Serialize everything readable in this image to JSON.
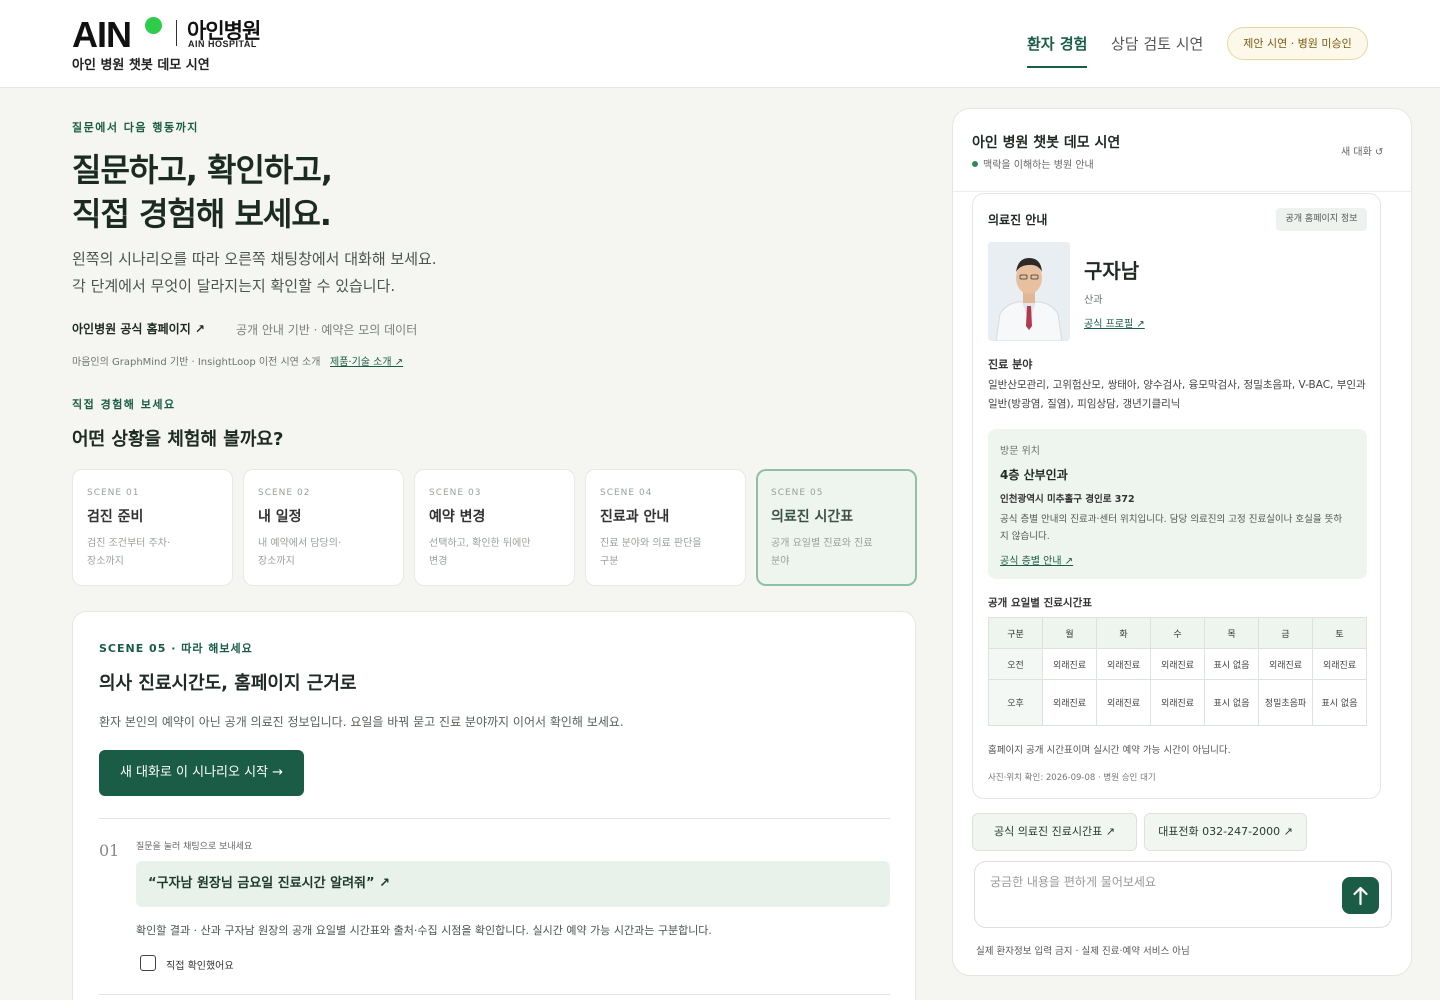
{
  "header": {
    "logo_text": "AIN",
    "logo_kr": "아인병원",
    "logo_en": "AIN HOSPITAL",
    "subtitle": "아인 병원 챗봇 데모 시연",
    "tabs": [
      {
        "label": "환자 경험",
        "active": true
      },
      {
        "label": "상담 검토 시연",
        "active": false
      }
    ],
    "badge": "제안 시연 · 병원 미승인"
  },
  "hero": {
    "eyebrow": "질문에서 다음 행동까지",
    "title_line1": "질문하고, 확인하고,",
    "title_line2": "직접 경험해 보세요.",
    "desc_line1": "왼쪽의 시나리오를 따라 오른쪽 채팅창에서 대화해 보세요.",
    "desc_line2": "각 단계에서 무엇이 달라지는지 확인할 수 있습니다.",
    "official_link": "아인병원 공식 홈페이지 ↗",
    "official_note": "공개 안내 기반 · 예약은 모의 데이터",
    "tech_note": "마음인의 GraphMind 기반 · InsightLoop 이전 시연 소개",
    "tech_link": "제품·기술 소개 ↗"
  },
  "scenes": {
    "eyebrow": "직접 경험해 보세요",
    "question": "어떤 상황을 체험해 볼까요?",
    "items": [
      {
        "label": "SCENE 01",
        "name": "검진 준비",
        "desc_1": "검진 조건부터 주차·",
        "desc_2": "장소까지",
        "active": false
      },
      {
        "label": "SCENE 02",
        "name": "내 일정",
        "desc_1": "내 예약에서 담당의·",
        "desc_2": "장소까지",
        "active": false
      },
      {
        "label": "SCENE 03",
        "name": "예약 변경",
        "desc_1": "선택하고, 확인한 뒤에만",
        "desc_2": "변경",
        "active": false
      },
      {
        "label": "SCENE 04",
        "name": "진료과 안내",
        "desc_1": "진료 분야와 의료 판단을",
        "desc_2": "구분",
        "active": false
      },
      {
        "label": "SCENE 05",
        "name": "의료진 시간표",
        "desc_1": "공개 요일별 진료와 진료",
        "desc_2": "분야",
        "active": true
      }
    ]
  },
  "panel": {
    "eyebrow": "SCENE 05 · 따라 해보세요",
    "title": "의사 진료시간도, 홈페이지 근거로",
    "desc": "환자 본인의 예약이 아닌 공개 의료진 정보입니다. 요일을 바꿔 묻고 진료 분야까지 이어서 확인해 보세요.",
    "start_button": "새 대화로 이 시나리오 시작 →",
    "step": {
      "number": "01",
      "hint": "질문을 눌러 채팅으로 보내세요",
      "question": "“구자남 원장님 금요일 진료시간 알려줘” ↗",
      "result": "확인할 결과 · 산과 구자남 원장의 공개 요일별 시간표와 출처·수집 시점을 확인합니다. 실시간 예약 가능 시간과는 구분합니다.",
      "check_label": "직접 확인했어요"
    }
  },
  "chat": {
    "title": "아인 병원 챗봇 데모 시연",
    "status": "맥락을 이해하는 병원 안내",
    "new_chat": "새 대화 ↺",
    "card": {
      "title": "의료진 안내",
      "badge": "공개 홈페이지 정보",
      "doctor_name": "구자남",
      "department": "산과",
      "profile_link": "공식 프로필 ↗",
      "specialty_heading": "진료 분야",
      "specialty": "일반산모관리, 고위험산모, 쌍태아, 양수검사, 융모막검사, 정밀초음파, V-BAC, 부인과 일반(방광염, 질염), 피임상담, 갱년기클리닉",
      "location": {
        "label": "방문 위치",
        "floor": "4층 산부인과",
        "address": "인천광역시 미추홀구 경인로 372",
        "note": "공식 층별 안내의 진료과·센터 위치입니다. 담당 의료진의 고정 진료실이나 호실을 뜻하지 않습니다.",
        "link": "공식 층별 안내 ↗"
      },
      "schedule_heading": "공개 요일별 진료시간표",
      "schedule": {
        "headers": [
          "구분",
          "월",
          "화",
          "수",
          "목",
          "금",
          "토"
        ],
        "rows": [
          [
            "오전",
            "외래진료",
            "외래진료",
            "외래진료",
            "표시 없음",
            "외래진료",
            "외래진료"
          ],
          [
            "오후",
            "외래진료",
            "외래진료",
            "외래진료",
            "표시 없음",
            "정밀초음파",
            "표시 없음"
          ]
        ]
      },
      "note": "홈페이지 공개 시간표이며 실시간 예약 가능 시간이 아닙니다.",
      "source": "사진·위치 확인: 2026-09-08 · 병원 승인 대기"
    },
    "chips": [
      "공식 의료진 진료시간표 ↗",
      "대표전화 032-247-2000 ↗"
    ],
    "input_placeholder": "궁금한 내용을 편하게 물어보세요",
    "footer": "실제 환자정보 입력 금지 · 실제 진료·예약 서비스 아님"
  },
  "colors": {
    "accent": "#1a5c46",
    "logo_dot": "#2fcc4a",
    "background": "#f5f6f1",
    "soft_green": "#eef5ef"
  },
  "icons": {
    "send": "arrow-up-icon",
    "new_chat": "refresh-icon",
    "external": "external-link-icon"
  }
}
